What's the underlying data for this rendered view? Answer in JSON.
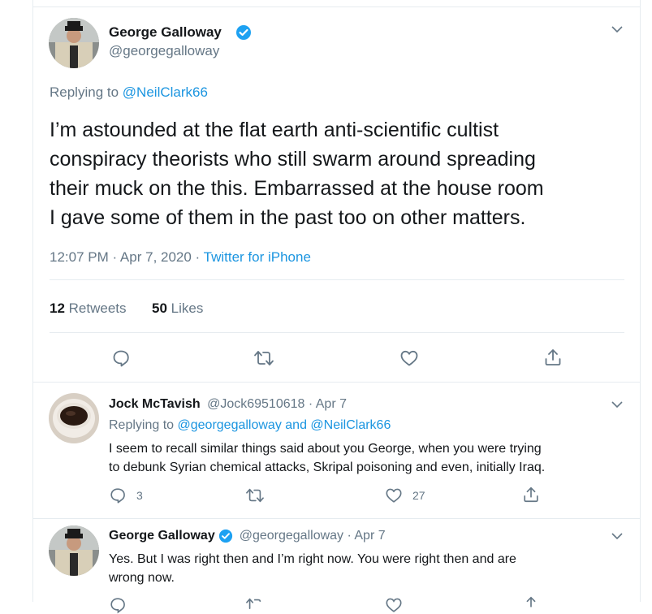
{
  "main_tweet": {
    "author_name": "George Galloway",
    "handle": "@georgegalloway",
    "replying_to_label": "Replying to",
    "replying_to_handle": "@NeilClark66",
    "text_lines": [
      "I’m astounded at the flat earth anti-scientific cultist",
      "conspiracy theorists who still swarm around spreading",
      "their muck on the this. Embarrassed at the house room",
      "I gave some of them in the past too on other matters."
    ],
    "time": "12:07 PM · Apr 7, 2020 · ",
    "source": "Twitter for iPhone",
    "retweets_count": "12",
    "retweets_label": "Retweets",
    "likes_count": "50",
    "likes_label": "Likes"
  },
  "replies": [
    {
      "author_name": "Jock McTavish",
      "meta": "@Jock69510618 · Apr 7",
      "replying_to_label": "Replying to",
      "replying_to_users": "@georgegalloway and @NeilClark66",
      "text_lines": [
        "I seem to recall similar things said about you George, when you were trying",
        "to debunk Syrian chemical attacks, Skripal poisoning and even, initially Iraq."
      ],
      "reply_count": "3",
      "like_count": "27"
    },
    {
      "author_name": "George Galloway",
      "meta": "@georgegalloway · Apr 7",
      "text_lines": [
        "Yes. But I was right then and I’m right now. You were right then and are",
        "wrong now."
      ]
    }
  ],
  "colors": {
    "text": "#14171a",
    "secondary": "#657786",
    "link": "#1b95e0",
    "verified": "#1da1f2",
    "divider": "#e6ecf0"
  },
  "icons": [
    "chevron-down-icon",
    "verified-badge-icon",
    "reply-icon",
    "retweet-icon",
    "like-icon",
    "share-icon"
  ]
}
